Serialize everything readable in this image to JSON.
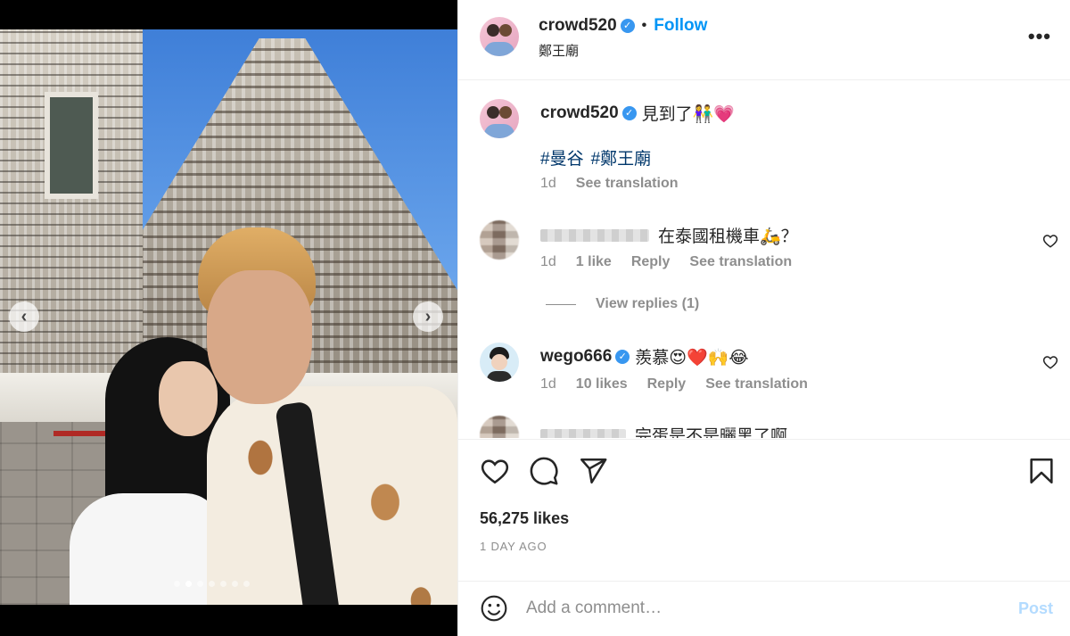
{
  "media": {
    "carousel_dots": 7,
    "active_dot": 1
  },
  "header": {
    "username": "crowd520",
    "separator": "•",
    "follow_label": "Follow",
    "location": "鄭王廟",
    "more_label": "•••"
  },
  "caption": {
    "username": "crowd520",
    "text": "見到了👫💗",
    "hashtags": [
      "#曼谷",
      "#鄭王廟"
    ],
    "time": "1d",
    "see_translation": "See translation"
  },
  "comments": [
    {
      "username": "",
      "text": "在泰國租機車🛵？",
      "time": "1d",
      "likes": "1 like",
      "reply": "Reply",
      "see_translation": "See translation",
      "view_replies": "View replies (1)"
    },
    {
      "username": "wego666",
      "text": "羨慕😍❤️🙌😂",
      "time": "1d",
      "likes": "10 likes",
      "reply": "Reply",
      "see_translation": "See translation"
    },
    {
      "username": "",
      "text": "完蛋是不是曬黑了啊"
    }
  ],
  "actions": {
    "likes": "56,275 likes",
    "date": "1 DAY AGO"
  },
  "add_comment": {
    "placeholder": "Add a comment…",
    "post_label": "Post"
  },
  "colors": {
    "follow_blue": "#0095f6",
    "hashtag": "#00376b",
    "muted": "#8e8e8e",
    "post_disabled": "#b3dbff",
    "verified": "#3897f0"
  }
}
